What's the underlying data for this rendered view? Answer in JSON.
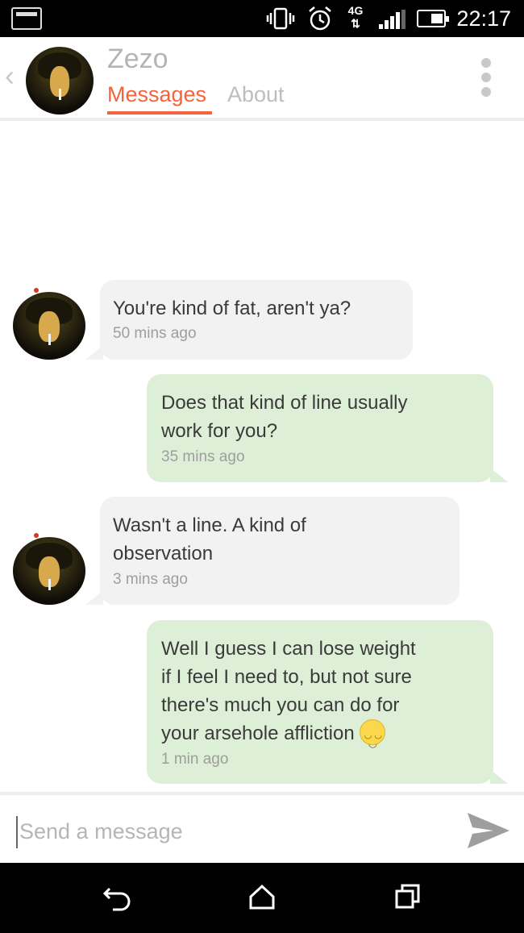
{
  "status_bar": {
    "time": "22:17",
    "network": "4G",
    "icons": [
      "screenshot-icon",
      "vibrate-icon",
      "alarm-icon",
      "4g-icon",
      "signal-icon",
      "battery-icon"
    ]
  },
  "header": {
    "contact_name": "Zezo",
    "tabs": [
      {
        "label": "Messages",
        "active": true
      },
      {
        "label": "About",
        "active": false
      }
    ]
  },
  "messages": [
    {
      "direction": "in",
      "lines": [
        "You're kind of fat, aren't ya?"
      ],
      "time": "50 mins ago"
    },
    {
      "direction": "out",
      "lines": [
        "Does that kind of line usually",
        "work for you?"
      ],
      "time": "35 mins ago"
    },
    {
      "direction": "in",
      "lines": [
        "Wasn't a line. A kind of",
        "observation"
      ],
      "time": "3 mins ago"
    },
    {
      "direction": "out",
      "lines": [
        "Well I guess I can lose weight",
        "if I feel I need to, but not sure",
        "there's much you can do for",
        "your arsehole affliction"
      ],
      "time": "1 min ago"
    }
  ],
  "composer": {
    "placeholder": "Send a message",
    "value": ""
  },
  "colors": {
    "accent": "#f4633c",
    "incoming_bubble": "#f2f2f2",
    "outgoing_bubble": "#ddefd6"
  }
}
